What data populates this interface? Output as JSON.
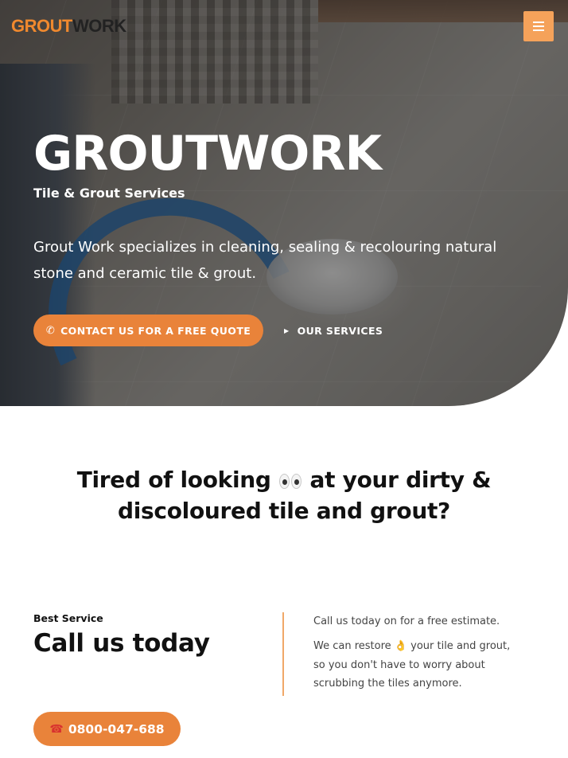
{
  "header": {
    "logo_part1": "GROUT",
    "logo_part2": "WORK",
    "menu_icon": "hamburger-icon"
  },
  "hero": {
    "title": "GROUTWORK",
    "subtitle": "Tile & Grout Services",
    "description": "Grout Work specializes in cleaning, sealing & recolouring natural stone and ceramic tile & grout.",
    "cta_primary": "CONTACT US FOR A FREE QUOTE",
    "cta_primary_icon": "phone-icon",
    "cta_secondary": "OUR SERVICES",
    "cta_secondary_icon": "caret-right-icon"
  },
  "headline": {
    "part1": "Tired of looking",
    "icon": "eyes-emoji",
    "part2": "at your dirty & discoloured tile and grout?"
  },
  "call": {
    "eyebrow": "Best Service",
    "title": "Call us today",
    "copy1": "Call us today on for a free estimate.",
    "copy2_a": "We can restore",
    "copy2_icon": "ok-hand-emoji",
    "copy2_b": "your tile and grout, so you don't have to worry about scrubbing the tiles anymore.",
    "phone": "0800-047-688",
    "phone_icon": "telephone-icon"
  },
  "colors": {
    "accent": "#e9833a",
    "menu_button": "#f5a25a",
    "divider": "#f0a868",
    "text_dark": "#111111",
    "text_muted": "#444444"
  }
}
